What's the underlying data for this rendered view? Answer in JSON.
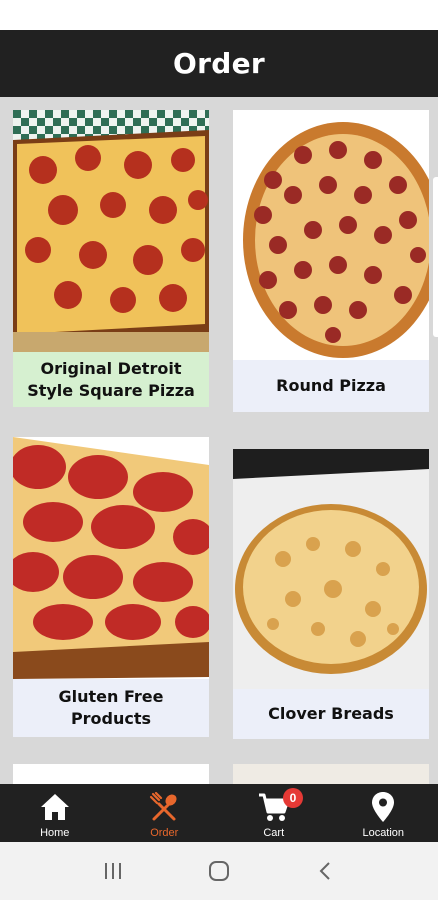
{
  "header": {
    "title": "Order"
  },
  "categories": [
    {
      "label": "Original Detroit Style Square Pizza",
      "image": "detroit-square-pepperoni-pizza"
    },
    {
      "label": "Round Pizza",
      "image": "round-pepperoni-pizza"
    },
    {
      "label": "Gluten Free Products",
      "image": "gluten-free-pepperoni-pizza"
    },
    {
      "label": "Clover Breads",
      "image": "cheese-bread"
    }
  ],
  "bottom_nav": {
    "items": [
      {
        "label": "Home",
        "icon": "home-icon"
      },
      {
        "label": "Order",
        "icon": "fork-spoon-icon",
        "active": true
      },
      {
        "label": "Cart",
        "icon": "cart-icon",
        "badge": "0"
      },
      {
        "label": "Location",
        "icon": "location-pin-icon"
      }
    ]
  },
  "system_nav": {
    "buttons": [
      "recents-icon",
      "home-circle-icon",
      "back-icon"
    ]
  },
  "colors": {
    "header_bg": "#212121",
    "active": "#e8672c",
    "badge": "#e53935",
    "card_bg": "#eceff9",
    "selected_caption": "#d6f0d0"
  }
}
